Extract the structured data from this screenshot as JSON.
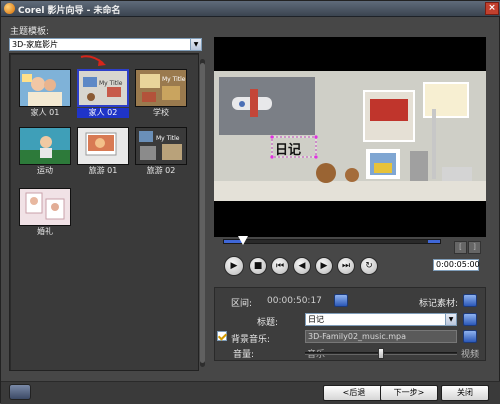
{
  "window": {
    "title": "Corel 影片向导 - 未命名"
  },
  "template_panel": {
    "label": "主题模板:",
    "selected_value": "3D-家庭影片",
    "templates": [
      {
        "label": "家人 01",
        "selected": false
      },
      {
        "label": "家人 02",
        "selected": true
      },
      {
        "label": "学校",
        "selected": false
      },
      {
        "label": "运动",
        "selected": false
      },
      {
        "label": "旅游 01",
        "selected": false
      },
      {
        "label": "旅游 02",
        "selected": false
      },
      {
        "label": "婚礼",
        "selected": false
      }
    ]
  },
  "preview": {
    "overlay_text": "日记",
    "timecode": "0:00:05:00",
    "playback_progress": 0.09
  },
  "options": {
    "duration_label": "区间:",
    "duration_value": "00:00:50:17",
    "mark_clips_label": "标记素材:",
    "title_label": "标题:",
    "title_value": "日记",
    "bg_music_label": "背景音乐:",
    "bg_music_checked": true,
    "bg_music_file": "3D-Family02_music.mpa",
    "volume_label": "音量:",
    "volume_left": "音乐",
    "volume_right": "视频",
    "volume_level": 0.5
  },
  "footer": {
    "back_label": "<后退",
    "next_label": "下一步>",
    "close_label": "关闭"
  },
  "colors": {
    "selection": "#1f34c8",
    "accent_blue": "#3f67d8",
    "close_red": "#c2402e"
  }
}
